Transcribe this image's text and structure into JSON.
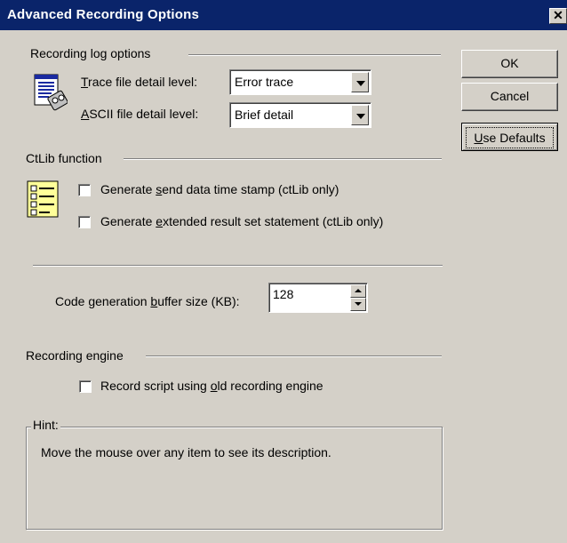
{
  "window": {
    "title": "Advanced Recording Options",
    "close_glyph": "✕"
  },
  "buttons": {
    "ok": "OK",
    "cancel": "Cancel",
    "use_defaults_u": "U",
    "use_defaults_rest": "se Defaults"
  },
  "recording_log": {
    "heading": "Recording log options",
    "trace_label_u": "T",
    "trace_label_rest": "race file detail level:",
    "trace_value": "Error trace",
    "ascii_label_u": "A",
    "ascii_label_rest": "SCII file detail level:",
    "ascii_value": "Brief detail",
    "icon": "log-file-icon"
  },
  "ctlib": {
    "heading": "CtLib function",
    "icon": "checklist-icon",
    "option1_pre": "Generate ",
    "option1_u": "s",
    "option1_post": "end data time stamp (ctLib only)",
    "option1_checked": false,
    "option2_pre": "Generate ",
    "option2_u": "e",
    "option2_post": "xtended result set statement (ctLib only)",
    "option2_checked": false
  },
  "buffer": {
    "label_pre": "Code generation ",
    "label_u": "b",
    "label_post": "uffer size (KB):",
    "value": "128"
  },
  "engine": {
    "heading": "Recording engine",
    "option_pre": "Record script using ",
    "option_u": "o",
    "option_post": "ld recording engine",
    "option_checked": false
  },
  "hint": {
    "heading": "Hint:",
    "text": "Move the mouse over any item to see its description."
  }
}
